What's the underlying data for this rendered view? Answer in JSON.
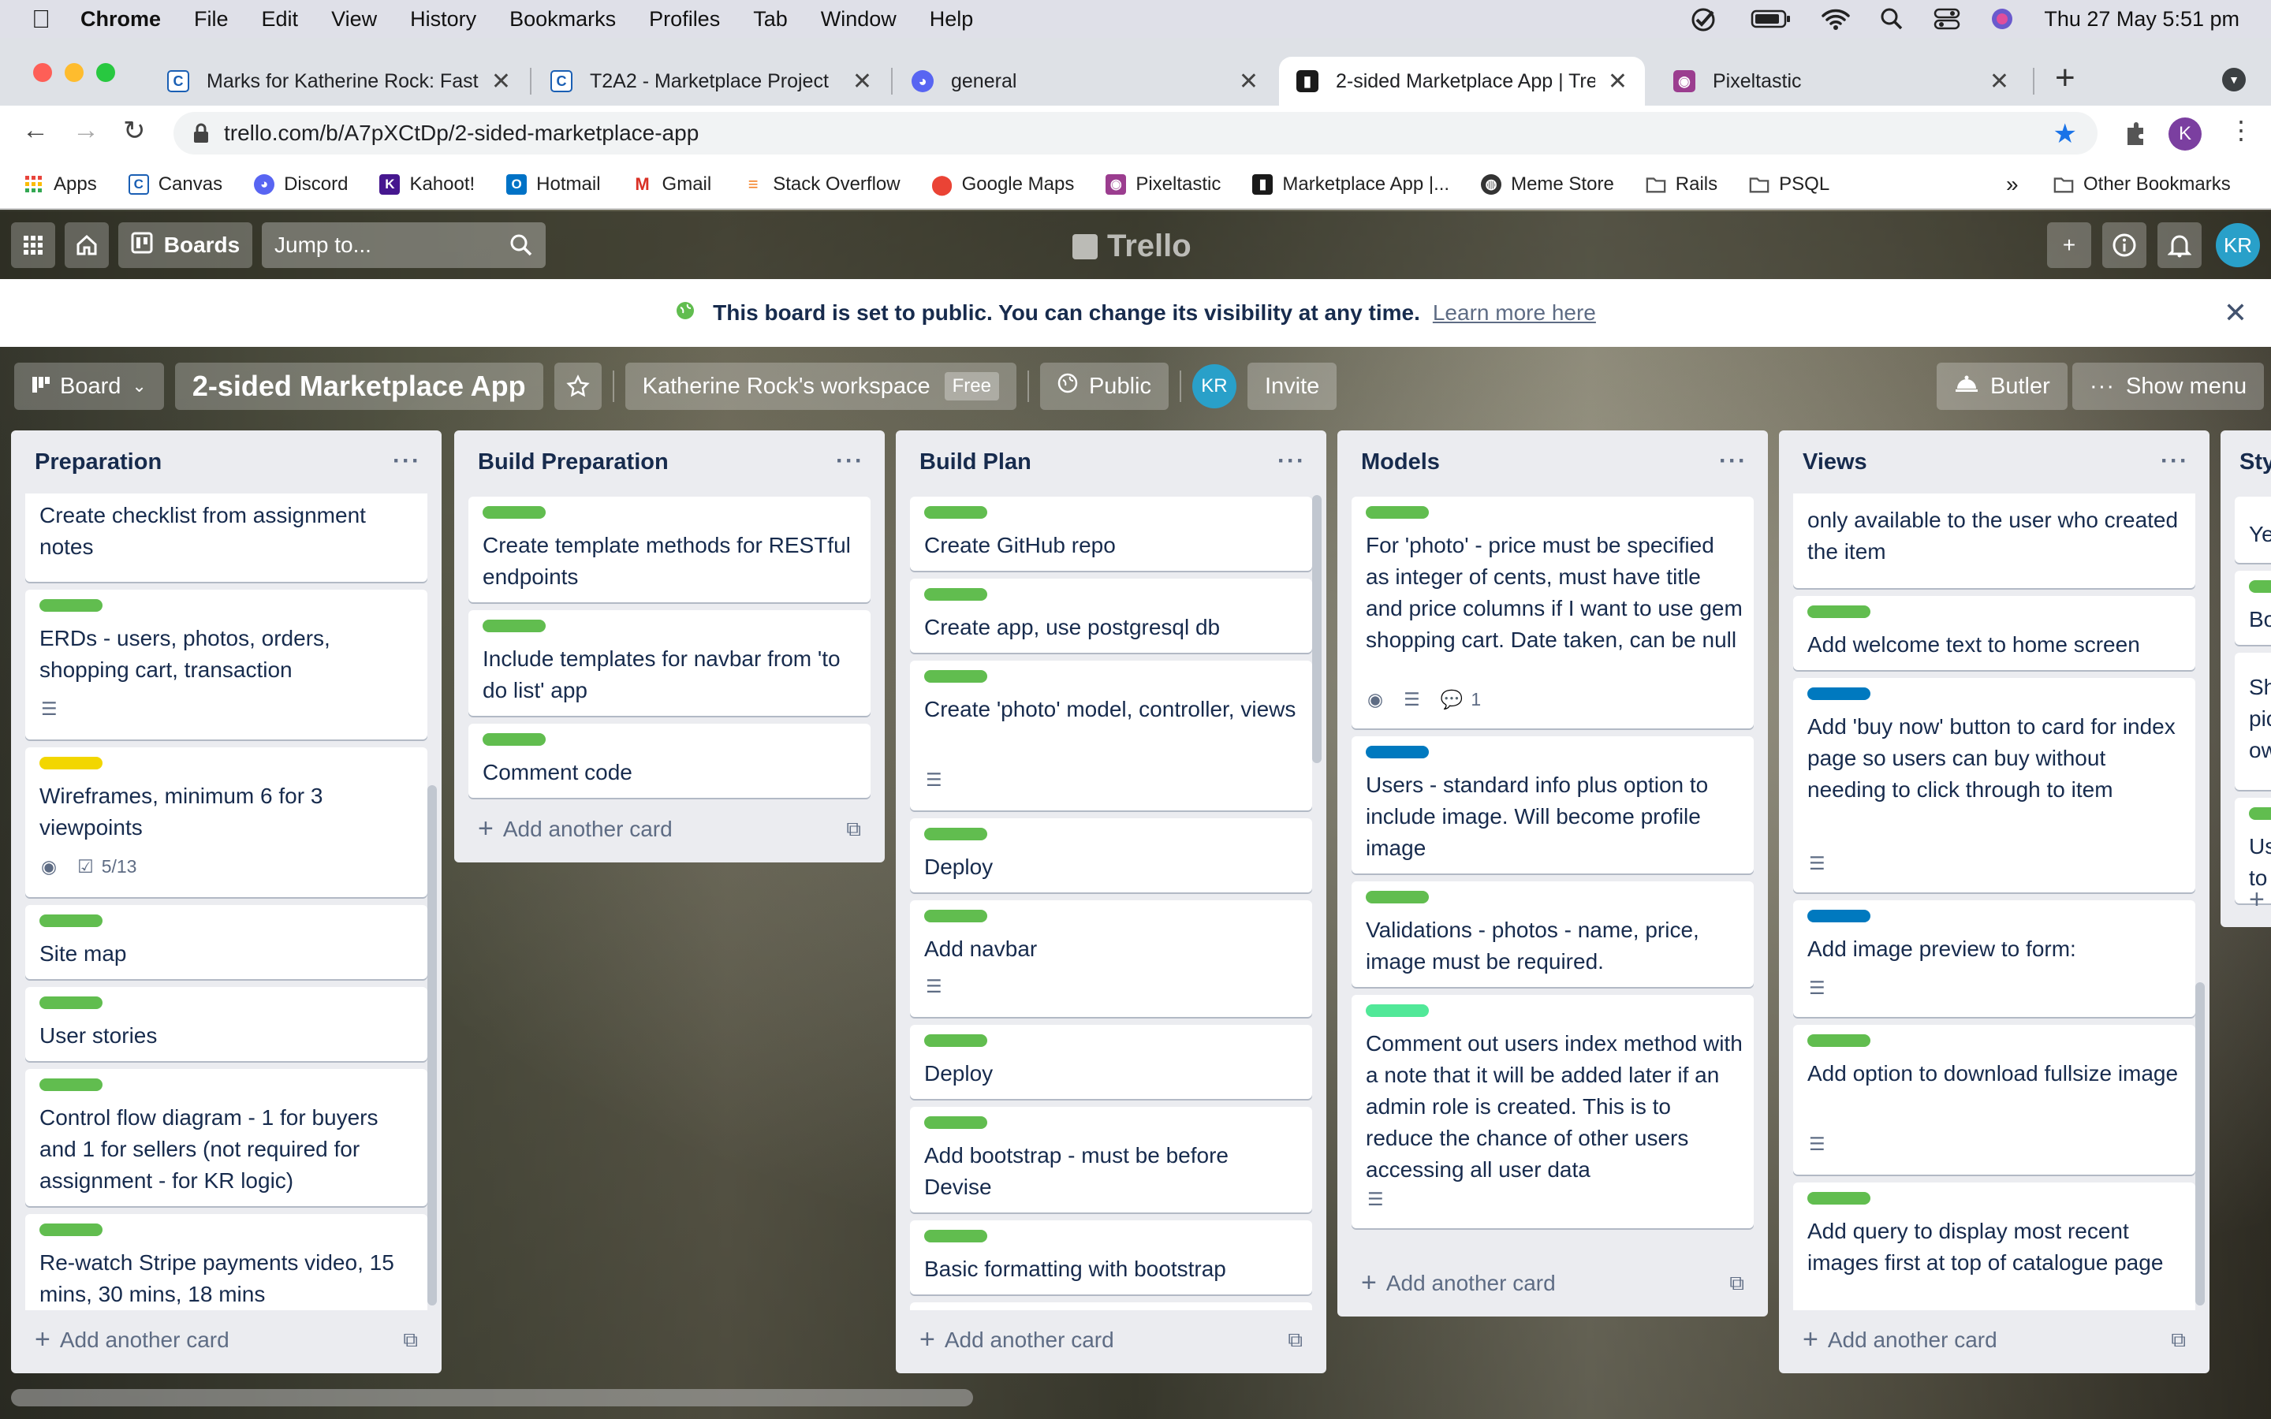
{
  "mac": {
    "apple": "",
    "app": "Chrome",
    "menus": [
      "File",
      "Edit",
      "View",
      "History",
      "Bookmarks",
      "Profiles",
      "Tab",
      "Window",
      "Help"
    ],
    "datetime": "Thu 27 May  5:51 pm"
  },
  "tabs": [
    {
      "title": "Marks for Katherine Rock: Fast",
      "icon": "canvas-icon"
    },
    {
      "title": "T2A2 - Marketplace Project",
      "icon": "canvas-icon"
    },
    {
      "title": "general",
      "icon": "discord-icon"
    },
    {
      "title": "2-sided Marketplace App | Trel",
      "icon": "trello-icon"
    },
    {
      "title": "Pixeltastic",
      "icon": "pixeltastic-icon"
    }
  ],
  "address": {
    "url": "trello.com/b/A7pXCtDp/2-sided-marketplace-app",
    "profile_initial": "K"
  },
  "bookmarks": [
    "Apps",
    "Canvas",
    "Discord",
    "Kahoot!",
    "Hotmail",
    "Gmail",
    "Stack Overflow",
    "Google Maps",
    "Pixeltastic",
    "Marketplace App |...",
    "Meme Store",
    "Rails",
    "PSQL"
  ],
  "bookmarks_more": "»",
  "bookmarks_other": "Other Bookmarks",
  "trello": {
    "boards_label": "Boards",
    "jump_placeholder": "Jump to...",
    "logo": "Trello",
    "avatar": "KR"
  },
  "banner": {
    "text": "This board is set to public. You can change its visibility at any time.",
    "link": "Learn more here"
  },
  "boardbar": {
    "view": "Board",
    "title": "2-sided Marketplace App",
    "workspace": "Katherine Rock's workspace",
    "plan": "Free",
    "visibility": "Public",
    "member": "KR",
    "invite": "Invite",
    "butler": "Butler",
    "show_menu": "Show menu"
  },
  "colors": {
    "green": "#61bd4f",
    "yellow": "#f2d600",
    "blue": "#0079bf",
    "lime": "#51e898"
  },
  "add_card": "Add another card",
  "lists": [
    {
      "title": "Preparation",
      "cards": [
        {
          "text": "Create checklist from assignment notes",
          "label": null
        },
        {
          "text": "ERDs - users, photos, orders, shopping cart, transaction",
          "label": "green",
          "desc": true
        },
        {
          "text": "Wireframes, minimum 6 for 3 viewpoints",
          "label": "yellow",
          "watch": true,
          "checklist": "5/13"
        },
        {
          "text": "Site map",
          "label": "green"
        },
        {
          "text": "User stories",
          "label": "green"
        },
        {
          "text": "Control flow diagram - 1 for buyers and 1 for sellers (not required for assignment - for KR logic)",
          "label": "green"
        },
        {
          "text": "Re-watch Stripe payments video, 15 mins, 30 mins, 18 mins",
          "label": "green"
        }
      ]
    },
    {
      "title": "Build Preparation",
      "cards": [
        {
          "text": "Create template methods for RESTful endpoints",
          "label": "green"
        },
        {
          "text": "Include templates for navbar from 'to do list' app",
          "label": "green"
        },
        {
          "text": "Comment code",
          "label": "green"
        }
      ]
    },
    {
      "title": "Build Plan",
      "cards": [
        {
          "text": "Create GitHub repo",
          "label": "green"
        },
        {
          "text": "Create app, use postgresql db",
          "label": "green"
        },
        {
          "text": "Create 'photo' model, controller, views",
          "label": "green",
          "desc": true
        },
        {
          "text": "Deploy",
          "label": "green"
        },
        {
          "text": "Add navbar",
          "label": "green",
          "desc": true
        },
        {
          "text": "Deploy",
          "label": "green"
        },
        {
          "text": "Add bootstrap - must be before Devise",
          "label": "green"
        },
        {
          "text": "Basic formatting with bootstrap",
          "label": "green"
        }
      ]
    },
    {
      "title": "Models",
      "cards": [
        {
          "text": "For 'photo' - price must be specified as integer of cents, must have title and price columns if I want to use gem shopping cart. Date taken, can be null",
          "label": "green",
          "watch": true,
          "desc": true,
          "comments": "1"
        },
        {
          "text": "Users - standard info plus option to include image. Will become profile image",
          "label": "blue"
        },
        {
          "text": "Validations - photos - name, price, image must be required.",
          "label": "green"
        },
        {
          "text": "Comment out users index method with a note that it will be added later if an admin role is created. This is to reduce the chance of other users accessing all user data",
          "label": "lime",
          "desc": true
        }
      ]
    },
    {
      "title": "Views",
      "cards": [
        {
          "text": "only available to the user who created the item",
          "label": null
        },
        {
          "text": "Add welcome text to home screen",
          "label": "green"
        },
        {
          "text": "Add 'buy now' button to card for index page so users can buy without needing to click through to item",
          "label": "blue",
          "desc": true
        },
        {
          "text": "Add image preview to form:",
          "label": "blue",
          "desc": true
        },
        {
          "text": "Add option to download fullsize image",
          "label": "green",
          "desc": true
        },
        {
          "text": "Add query to display most recent images first at top of catalogue page",
          "label": "green"
        }
      ]
    },
    {
      "title": "Sty",
      "cards": [
        {
          "text": "Ye",
          "label": null
        },
        {
          "text": "Bo",
          "label": "green"
        },
        {
          "text": "Sh pic ow",
          "label": null
        },
        {
          "text": "Us to",
          "label": "green"
        }
      ]
    }
  ]
}
